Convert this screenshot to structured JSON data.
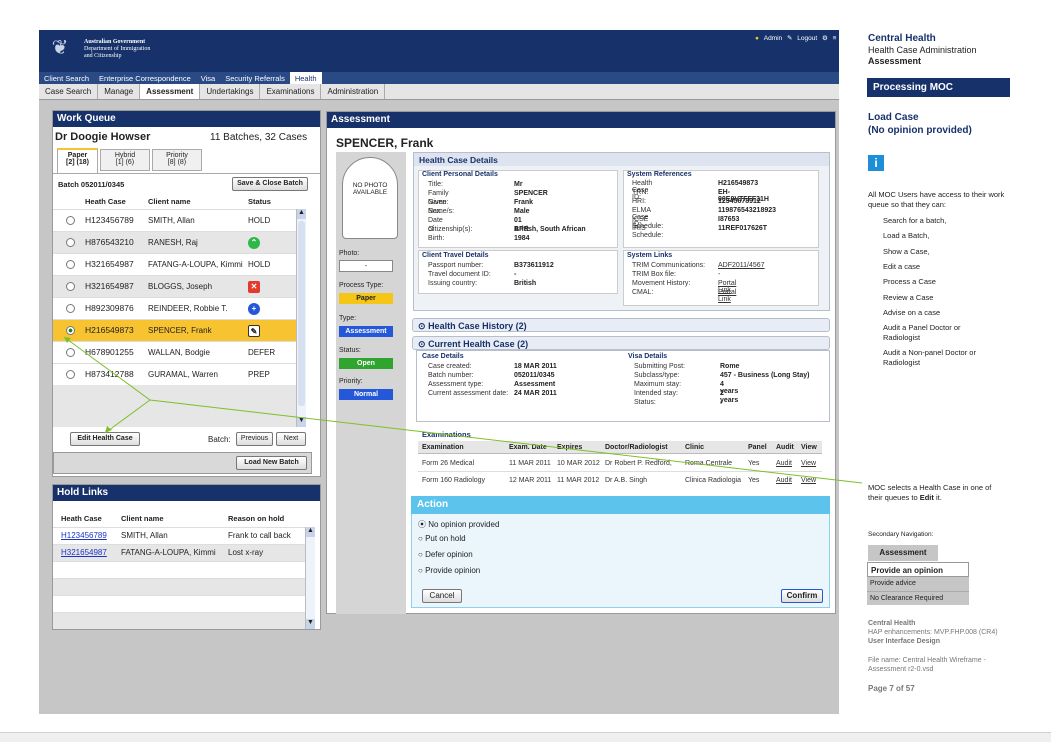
{
  "app": {
    "gov_line1": "Australian Government",
    "gov_line2": "Department of Immigration",
    "gov_line3": "and Citizenship",
    "user_links": [
      "Admin",
      "Logout"
    ],
    "tabs": [
      "Client Search",
      "Enterprise Correspondence",
      "Visa",
      "Security Referrals",
      "Health"
    ],
    "active_tab": "Health",
    "subtabs": [
      "Case Search",
      "Manage",
      "Assessment",
      "Undertakings",
      "Examinations",
      "Administration"
    ],
    "active_subtab": "Assessment"
  },
  "work_queue": {
    "title": "Work Queue",
    "doctor": "Dr Doogie Howser",
    "summary": "11 Batches, 32 Cases",
    "queue_tabs": [
      {
        "label": "Paper",
        "count": "[2] (18)"
      },
      {
        "label": "Hybrid",
        "count": "[1] (6)"
      },
      {
        "label": "Priority",
        "count": "[8] (8)"
      }
    ],
    "batch_label": "Batch 052011/0345",
    "save_close_label": "Save & Close Batch",
    "columns": [
      "Heath Case",
      "Client name",
      "Status"
    ],
    "rows": [
      {
        "id": "H123456789",
        "name": "SMITH, Allan",
        "status": "HOLD",
        "icon": ""
      },
      {
        "id": "H876543210",
        "name": "RANESH, Raj",
        "status": "",
        "icon": "chevron-up-icon"
      },
      {
        "id": "H321654987",
        "name": "FATANG-A-LOUPA, Kimmi",
        "status": "HOLD",
        "icon": ""
      },
      {
        "id": "H321654987",
        "name": "BLOGGS, Joseph",
        "status": "",
        "icon": "error-x-icon"
      },
      {
        "id": "H892309876",
        "name": "REINDEER, Robbie T.",
        "status": "",
        "icon": "plus-circle-icon"
      },
      {
        "id": "H216549873",
        "name": "SPENCER, Frank",
        "status": "",
        "icon": "edit-icon"
      },
      {
        "id": "H678901255",
        "name": "WALLAN, Bodgie",
        "status": "DEFER",
        "icon": ""
      },
      {
        "id": "H873412788",
        "name": "GURAMAL, Warren",
        "status": "PREP",
        "icon": ""
      }
    ],
    "edit_label": "Edit Health Case",
    "batch_nav_label": "Batch:",
    "previous_label": "Previous",
    "next_label": "Next",
    "load_new_label": "Load New Batch"
  },
  "hold_links": {
    "title": "Hold Links",
    "columns": [
      "Heath Case",
      "Client name",
      "Reason on hold"
    ],
    "rows": [
      {
        "id": "H123456789",
        "name": "SMITH, Allan",
        "reason": "Frank to call back"
      },
      {
        "id": "H321654987",
        "name": "FATANG-A-LOUPA, Kimmi",
        "reason": "Lost x-ray"
      }
    ]
  },
  "assessment": {
    "title": "Assessment",
    "client_name": "SPENCER, Frank",
    "no_photo": "NO PHOTO AVAILABLE",
    "photo_label": "Photo:",
    "photo_value": "-",
    "process_type_label": "Process Type:",
    "process_type": "Paper",
    "type_label": "Type:",
    "type": "Assessment",
    "status_label": "Status:",
    "status": "Open",
    "priority_label": "Priority:",
    "priority": "Normal",
    "details_title": "Health Case Details",
    "personal_title": "Client Personal Details",
    "personal": [
      [
        "Title:",
        "Mr"
      ],
      [
        "Family Name:",
        "SPENCER"
      ],
      [
        "Given Name/s:",
        "Frank"
      ],
      [
        "Sex:",
        "Male"
      ],
      [
        "Date of Birth:",
        "01 APR 1984"
      ],
      [
        "Citizenship(s):",
        "British, South African"
      ]
    ],
    "system_title": "System References",
    "system": [
      [
        "Health Case ID:",
        "H216549873"
      ],
      [
        "TRN:",
        "EH-00E0VTFFF31H"
      ],
      [
        "HRI:",
        "12345678912"
      ],
      [
        "ELMA Case ID:",
        "119876543218923"
      ],
      [
        "ICSE Schedule:",
        "I87653"
      ],
      [
        "IRIS Schedule:",
        "11REF017626T"
      ]
    ],
    "travel_title": "Client Travel Details",
    "travel": [
      [
        "Passport number:",
        "B373611912"
      ],
      [
        "Travel document ID:",
        "-"
      ],
      [
        "Issuing country:",
        "British"
      ]
    ],
    "links_title": "System Links",
    "links": [
      [
        "TRIM Communications:",
        "ADF2011/4567"
      ],
      [
        "TRIM Box file:",
        "-"
      ],
      [
        "Movement History:",
        "Portal Link"
      ],
      [
        "CMAL:",
        "Portal Link"
      ]
    ],
    "history_label": "Health Case History (2)",
    "current_label": "Current Health Case (2)",
    "case_title": "Case Details",
    "case": [
      [
        "Case created:",
        "18 MAR 2011"
      ],
      [
        "Batch number:",
        "052011/0345"
      ],
      [
        "Assessment type:",
        "Assessment"
      ],
      [
        "Current assessment date:",
        "24 MAR 2011"
      ]
    ],
    "visa_title": "Visa Details",
    "visa": [
      [
        "Submitting Post:",
        "Rome"
      ],
      [
        "Subclass/type:",
        "457 - Business (Long Stay)"
      ],
      [
        "Maximum stay:",
        "4 years"
      ],
      [
        "Intended stay:",
        "2 years"
      ],
      [
        "Status:",
        "-"
      ]
    ],
    "exams_title": "Examinations",
    "exam_columns": [
      "Examination",
      "Exam. Date",
      "Expires",
      "Doctor/Radiologist",
      "Clinic",
      "Panel",
      "Audit",
      "View"
    ],
    "exams": [
      [
        "Form 26 Medical",
        "11 MAR 2011",
        "10 MAR 2012",
        "Dr Robert P. Redford,",
        "Roma Centrale",
        "Yes",
        "Audit",
        "View"
      ],
      [
        "Form 160 Radiology",
        "12 MAR 2011",
        "11 MAR 2012",
        "Dr A.B. Singh",
        "Clinica Radiologia",
        "Yes",
        "Audit",
        "View"
      ]
    ],
    "action_title": "Action",
    "actions": [
      "No opinion provided",
      "Put on hold",
      "Defer opinion",
      "Provide opinion"
    ],
    "cancel_label": "Cancel",
    "confirm_label": "Confirm"
  },
  "sidebar": {
    "h1": "Central Health",
    "h2": "Health Case Administration",
    "h3": "Assessment",
    "banner": "Processing MOC",
    "load_case": "Load Case",
    "no_opinion": "(No opinion provided)",
    "access_text": "All MOC Users have access to their work queue so that they can:",
    "abilities": [
      "Search for a batch,",
      "Load a Batch,",
      "Show a Case,",
      "Edit a case",
      "Process a Case",
      "Review a Case",
      "Advise on a case",
      "Audit a Panel Doctor or Radiologist",
      "Audit a Non-panel Doctor  or Radiologist"
    ],
    "note_pre": "MOC selects a Health Case in one of their queues to ",
    "note_bold": "Edit",
    "note_post": " it.",
    "sec_nav_label": "Secondary Navigation:",
    "sec_nav_head": "Assessment",
    "sec_nav": [
      "Provide an opinion",
      "Provide advice",
      "No Clearance Required"
    ],
    "footer1": "Central Health",
    "footer2": "HAP enhancements: MVP.FHP.008 (CR4)",
    "footer3": "User Interface Design",
    "file_name": "File name: Central Health Wireframe - Assessment r2-0.vsd",
    "page": "Page 7 of 57"
  },
  "colors": {
    "navy": "#17316a",
    "selected": "#f7c331",
    "blue_pill": "#2458d8",
    "green_pill": "#2fa52f",
    "paper": "#f5c518"
  }
}
